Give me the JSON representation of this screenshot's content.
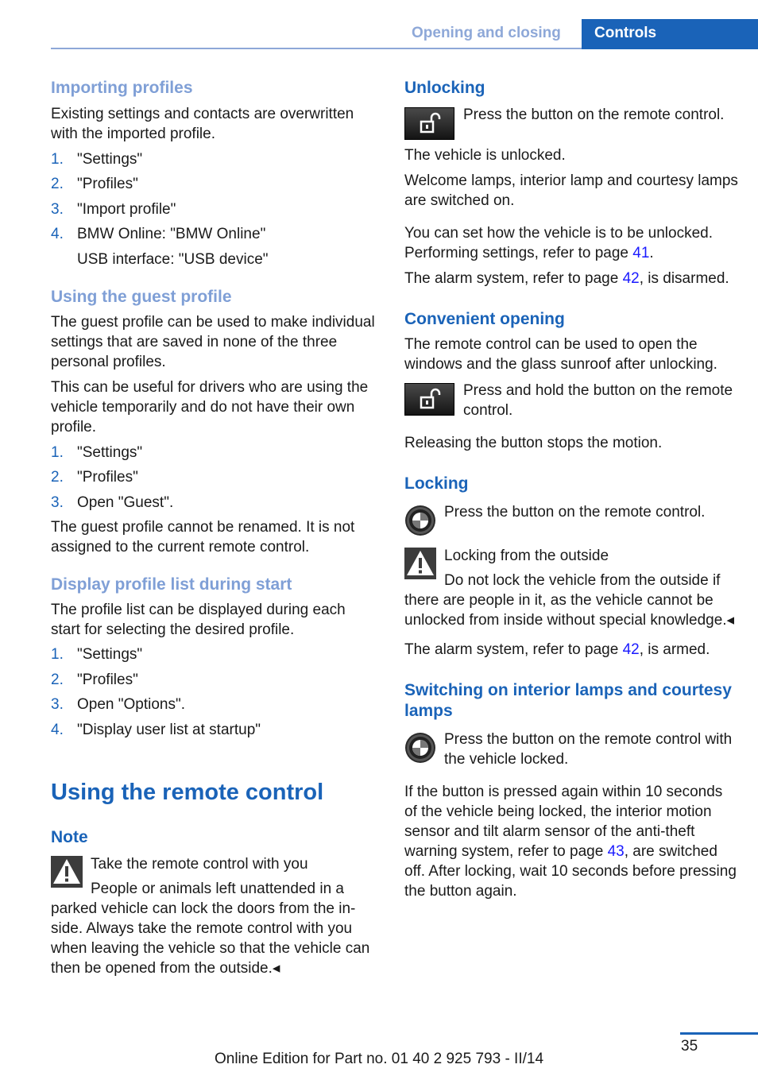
{
  "header": {
    "section": "Opening and closing",
    "chapter": "Controls"
  },
  "left": {
    "importing": {
      "heading": "Importing profiles",
      "text": "Existing settings and contacts are overwritten with the imported profile.",
      "steps": [
        {
          "num": "1.",
          "text": "\"Settings\""
        },
        {
          "num": "2.",
          "text": "\"Profiles\""
        },
        {
          "num": "3.",
          "text": "\"Import profile\""
        },
        {
          "num": "4.",
          "text": "BMW Online: \"BMW Online\"",
          "sub": "USB interface: \"USB device\""
        }
      ]
    },
    "guest": {
      "heading": "Using the guest profile",
      "text1": "The guest profile can be used to make individ­ual settings that are saved in none of the three personal profiles.",
      "text2": "This can be useful for drivers who are using the vehicle temporarily and do not have their own profile.",
      "steps": [
        {
          "num": "1.",
          "text": "\"Settings\""
        },
        {
          "num": "2.",
          "text": "\"Profiles\""
        },
        {
          "num": "3.",
          "text": "Open \"Guest\"."
        }
      ],
      "text3": "The guest profile cannot be renamed. It is not assigned to the current remote control."
    },
    "display_list": {
      "heading": "Display profile list during start",
      "text": "The profile list can be displayed during each start for selecting the desired profile.",
      "steps": [
        {
          "num": "1.",
          "text": "\"Settings\""
        },
        {
          "num": "2.",
          "text": "\"Profiles\""
        },
        {
          "num": "3.",
          "text": "Open \"Options\"."
        },
        {
          "num": "4.",
          "text": "\"Display user list at startup\""
        }
      ]
    },
    "remote": {
      "title": "Using the remote control",
      "note_heading": "Note",
      "warning_title": "Take the remote control with you",
      "warning_text": "People or animals left unattended in a parked vehicle can lock the doors from the in­side. Always take the remote control with you when leaving the vehicle so that the vehicle can then be opened from the outside.◂"
    }
  },
  "right": {
    "unlocking": {
      "heading": "Unlocking",
      "icon": "unlock-button-icon",
      "icon_text": "Press the button on the remote con­trol.",
      "text1": "The vehicle is unlocked.",
      "text2": "Welcome lamps, interior lamp and courtesy lamps are switched on.",
      "text3_pre": "You can set how the vehicle is to be unlocked. Performing settings, refer to page ",
      "text3_link": "41",
      "text3_post": ".",
      "text4_pre": "The alarm system, refer to page ",
      "text4_link": "42",
      "text4_post": ", is dis­armed."
    },
    "convenient": {
      "heading": "Convenient opening",
      "text": "The remote control can be used to open the windows and the glass sunroof after unlocking.",
      "icon": "unlock-button-icon",
      "icon_text": "Press and hold the button on the re­mote control.",
      "text2": "Releasing the button stops the motion."
    },
    "locking": {
      "heading": "Locking",
      "icon": "bmw-logo-button-icon",
      "icon_text": "Press the button on the remote control.",
      "warning_title": "Locking from the outside",
      "warning_text": "Do not lock the vehicle from the outside if there are people in it, as the vehicle cannot be unlocked from inside without special knowl­edge.◂",
      "text_pre": "The alarm system, refer to page ",
      "text_link": "42",
      "text_post": ", is armed."
    },
    "lamps": {
      "heading": "Switching on interior lamps and courtesy lamps",
      "icon": "bmw-logo-button-icon",
      "icon_text": "Press the button on the remote control with the vehicle locked.",
      "text_pre": "If the button is pressed again within 10 sec­onds of the vehicle being locked, the interior motion sensor and tilt alarm sensor of the anti-theft warning system, refer to page ",
      "text_link": "43",
      "text_post": ", are switched off. After locking, wait 10 seconds before pressing the button again."
    }
  },
  "footer": {
    "edition": "Online Edition for Part no. 01 40 2 925 793 - II/14",
    "page_number": "35"
  },
  "colors": {
    "brand_blue": "#1a63b8",
    "light_blue": "#7f9fd6",
    "link_blue": "#1a1aff"
  }
}
